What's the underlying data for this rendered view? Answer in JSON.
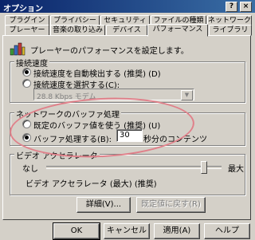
{
  "window": {
    "title": "オプション",
    "help_glyph": "?",
    "close_glyph": "×"
  },
  "tabs": {
    "row1": [
      "プラグイン",
      "プライバシー",
      "セキュリティ",
      "ファイルの種類",
      "ネットワーク"
    ],
    "row2": [
      "プレーヤー",
      "音楽の取り込み",
      "デバイス",
      "パフォーマンス",
      "ライブラリ"
    ],
    "active": "パフォーマンス"
  },
  "header": {
    "description": "プレーヤーのパフォーマンスを設定します。"
  },
  "connection_speed": {
    "legend": "接続速度",
    "auto_label": "接続速度を自動検出する (推奨) (D)",
    "auto_selected": true,
    "choose_label": "接続速度を選択する(C):",
    "choose_selected": false,
    "combo_value": "28.8 Kbps モデム"
  },
  "buffering": {
    "legend": "ネットワークのバッファ処理",
    "default_label": "既定のバッファ値を使う (推奨) (U)",
    "default_selected": false,
    "buffer_label": "バッファ処理する(B):",
    "buffer_selected": true,
    "seconds_value": "30",
    "seconds_suffix": "秒分のコンテンツ"
  },
  "video_accel": {
    "legend": "ビデオ アクセラレータ",
    "min_label": "なし",
    "max_label": "最大",
    "level_fraction": 0.9,
    "status": "ビデオ アクセラレータ (最大) (推奨)"
  },
  "panel_buttons": {
    "advanced": "詳細(V)...",
    "restore": "既定値に戻す(R)"
  },
  "footer": {
    "ok": "OK",
    "cancel": "キャンセル",
    "apply": "適用(A)",
    "help": "ヘルプ"
  },
  "colors": {
    "titlebar": "#0a246a",
    "face": "#d4d0c8",
    "annotation": "#e0808a"
  },
  "icons": {
    "player": "bar-chart-icon"
  }
}
